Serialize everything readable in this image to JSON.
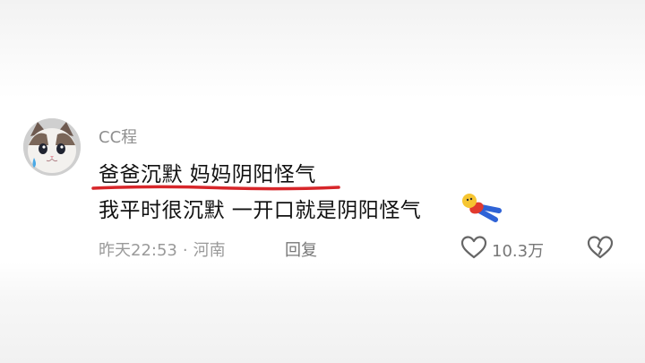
{
  "comment": {
    "username": "CC程",
    "text_line1": "爸爸沉默 妈妈阴阳怪气",
    "text_line2": "我平时很沉默 一开口就是阴阳怪气",
    "time": "昨天22:53",
    "separator": "·",
    "location": "河南",
    "reply_label": "回复",
    "like_count": "10.3万"
  },
  "icons": {
    "like": "heart-outline-icon",
    "dislike": "broken-heart-icon",
    "sticker": "lying-down-emoji-sticker",
    "avatar": "cat-avatar"
  },
  "colors": {
    "underline": "#d7262a",
    "username": "#8f8f8f",
    "meta": "#9a9a9a",
    "text": "#111111"
  }
}
